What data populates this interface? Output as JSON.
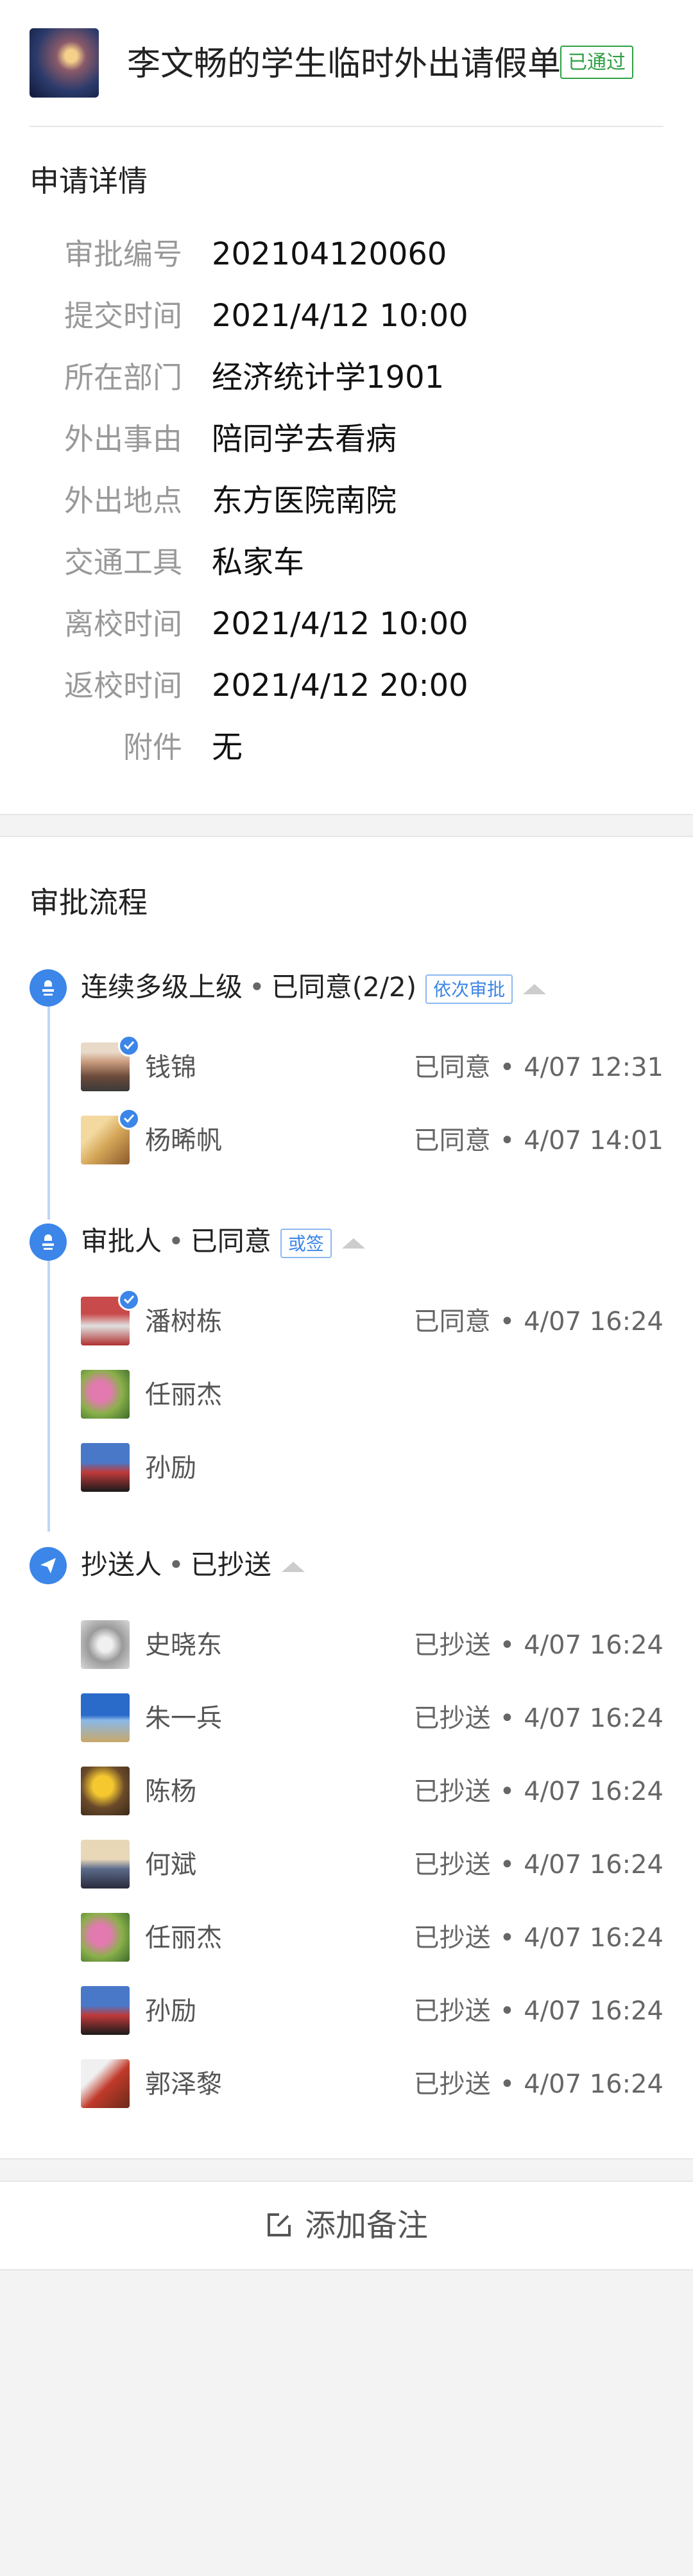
{
  "header": {
    "title": "李文畅的学生临时外出请假单",
    "status_badge": "已通过"
  },
  "details": {
    "section_title": "申请详情",
    "rows": [
      {
        "label": "审批编号",
        "value": "202104120060"
      },
      {
        "label": "提交时间",
        "value": "2021/4/12 10:00"
      },
      {
        "label": "所在部门",
        "value": "经济统计学1901"
      },
      {
        "label": "外出事由",
        "value": "陪同学去看病"
      },
      {
        "label": "外出地点",
        "value": "东方医院南院"
      },
      {
        "label": "交通工具",
        "value": "私家车"
      },
      {
        "label": "离校时间",
        "value": "2021/4/12 10:00"
      },
      {
        "label": "返校时间",
        "value": "2021/4/12 20:00"
      },
      {
        "label": "附件",
        "value": "无"
      }
    ]
  },
  "flow": {
    "section_title": "审批流程",
    "separator": "•",
    "stages": [
      {
        "name": "连续多级上级",
        "status": "已同意(2/2)",
        "tag": "依次审批",
        "people": [
          {
            "name": "钱锦",
            "status": "已同意",
            "time": "4/07 12:31",
            "approved": true
          },
          {
            "name": "杨晞帆",
            "status": "已同意",
            "time": "4/07 14:01",
            "approved": true
          }
        ]
      },
      {
        "name": "审批人",
        "status": "已同意",
        "tag": "或签",
        "people": [
          {
            "name": "潘树栋",
            "status": "已同意",
            "time": "4/07 16:24",
            "approved": true
          },
          {
            "name": "任丽杰",
            "status": "",
            "time": "",
            "approved": false
          },
          {
            "name": "孙励",
            "status": "",
            "time": "",
            "approved": false
          }
        ]
      },
      {
        "name": "抄送人",
        "status": "已抄送",
        "tag": "",
        "people": [
          {
            "name": "史晓东",
            "status": "已抄送",
            "time": "4/07 16:24",
            "approved": false
          },
          {
            "name": "朱一兵",
            "status": "已抄送",
            "time": "4/07 16:24",
            "approved": false
          },
          {
            "name": "陈杨",
            "status": "已抄送",
            "time": "4/07 16:24",
            "approved": false
          },
          {
            "name": "何斌",
            "status": "已抄送",
            "time": "4/07 16:24",
            "approved": false
          },
          {
            "name": "任丽杰",
            "status": "已抄送",
            "time": "4/07 16:24",
            "approved": false
          },
          {
            "name": "孙励",
            "status": "已抄送",
            "time": "4/07 16:24",
            "approved": false
          },
          {
            "name": "郭泽黎",
            "status": "已抄送",
            "time": "4/07 16:24",
            "approved": false
          }
        ]
      }
    ]
  },
  "footer": {
    "add_note_label": "添加备注"
  }
}
